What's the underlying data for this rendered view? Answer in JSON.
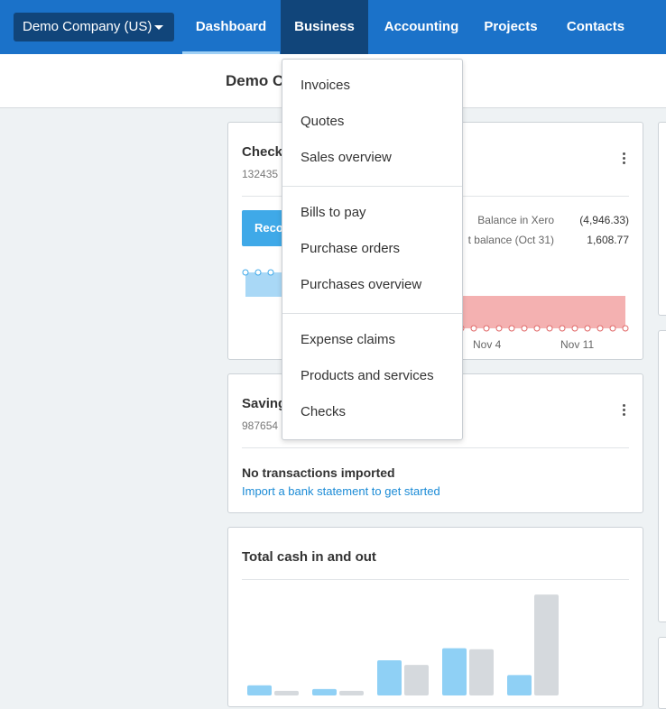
{
  "nav": {
    "org_name": "Demo Company (US)",
    "items": [
      {
        "label": "Dashboard"
      },
      {
        "label": "Business"
      },
      {
        "label": "Accounting"
      },
      {
        "label": "Projects"
      },
      {
        "label": "Contacts"
      }
    ]
  },
  "page": {
    "title": "Demo C"
  },
  "checking_card": {
    "title": "Check",
    "account_number": "132435",
    "reconcile_label": "Reco",
    "balance_in_xero_label": "Balance in Xero",
    "balance_in_xero_value": "(4,946.33)",
    "statement_balance_label": "t balance (Oct 31)",
    "statement_balance_value": "1,608.77",
    "axis_labels": [
      "Nov 4",
      "Nov 11"
    ],
    "colors": {
      "positive": "#a9d8f6",
      "negative": "#f4b1b1"
    }
  },
  "savings_card": {
    "title": "Saving",
    "account_number": "987654",
    "empty_title": "No transactions imported",
    "empty_link": "Import a bank statement to get started"
  },
  "cash_card": {
    "title": "Total cash in and out",
    "colors": {
      "in": "#8fd0f5",
      "out": "#d5d9dd"
    },
    "chart_data": {
      "type": "bar",
      "categories": [
        "",
        "",
        "",
        "",
        ""
      ],
      "series": [
        {
          "values": [
            11,
            7,
            38,
            51,
            22
          ]
        },
        {
          "values": [
            5,
            5,
            33,
            50,
            109
          ]
        }
      ],
      "ylim": [
        0,
        115
      ]
    }
  },
  "business_menu": {
    "groups": [
      [
        "Invoices",
        "Quotes",
        "Sales overview"
      ],
      [
        "Bills to pay",
        "Purchase orders",
        "Purchases overview"
      ],
      [
        "Expense claims",
        "Products and services",
        "Checks"
      ]
    ]
  }
}
